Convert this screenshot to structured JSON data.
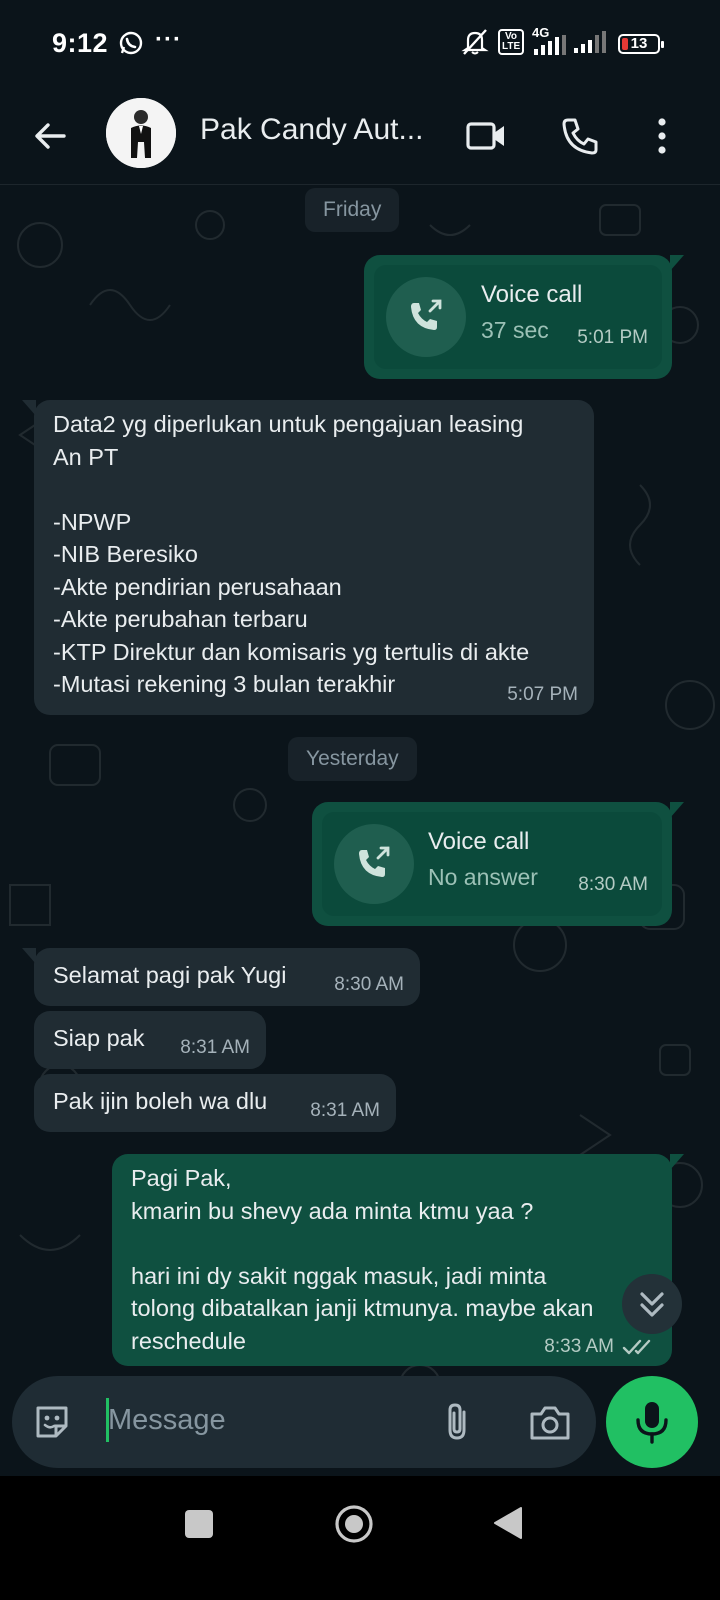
{
  "status_bar": {
    "time": "9:12",
    "dots": "···",
    "network": "4G",
    "volte": "Vo LTE",
    "battery": "13"
  },
  "header": {
    "contact_name": "Pak Candy Aut..."
  },
  "messages": [
    {
      "kind": "date",
      "text": "Friday"
    },
    {
      "kind": "call",
      "direction": "out",
      "title": "Voice call",
      "sub": "37 sec",
      "time": "5:01 PM"
    },
    {
      "kind": "text",
      "direction": "in",
      "text": "Data2 yg diperlukan untuk pengajuan leasing\nAn PT\n\n-NPWP\n-NIB Beresiko\n-Akte pendirian perusahaan\n-Akte perubahan terbaru\n-KTP Direktur dan komisaris yg tertulis di akte\n-Mutasi rekening 3 bulan terakhir",
      "time": "5:07 PM"
    },
    {
      "kind": "date",
      "text": "Yesterday"
    },
    {
      "kind": "call",
      "direction": "out",
      "title": "Voice call",
      "sub": "No answer",
      "time": "8:30 AM"
    },
    {
      "kind": "text",
      "direction": "in",
      "text": "Selamat pagi pak Yugi",
      "time": "8:30 AM"
    },
    {
      "kind": "text",
      "direction": "in",
      "text": "Siap pak",
      "time": "8:31 AM"
    },
    {
      "kind": "text",
      "direction": "in",
      "text": "Pak ijin boleh wa dlu",
      "time": "8:31 AM"
    },
    {
      "kind": "text",
      "direction": "out",
      "text": "Pagi Pak,\nkmarin bu shevy ada minta ktmu yaa ?\n\nhari ini dy sakit nggak masuk, jadi minta\ntolong dibatalkan janji ktmunya. maybe akan\nreschedule",
      "time": "8:33 AM",
      "status": "read"
    }
  ],
  "composer": {
    "placeholder": "Message"
  },
  "colors": {
    "background": "#0b141a",
    "incoming_bubble": "#202c33",
    "outgoing_bubble": "#0f5040",
    "accent": "#21c063",
    "battery_low": "#e53935"
  }
}
